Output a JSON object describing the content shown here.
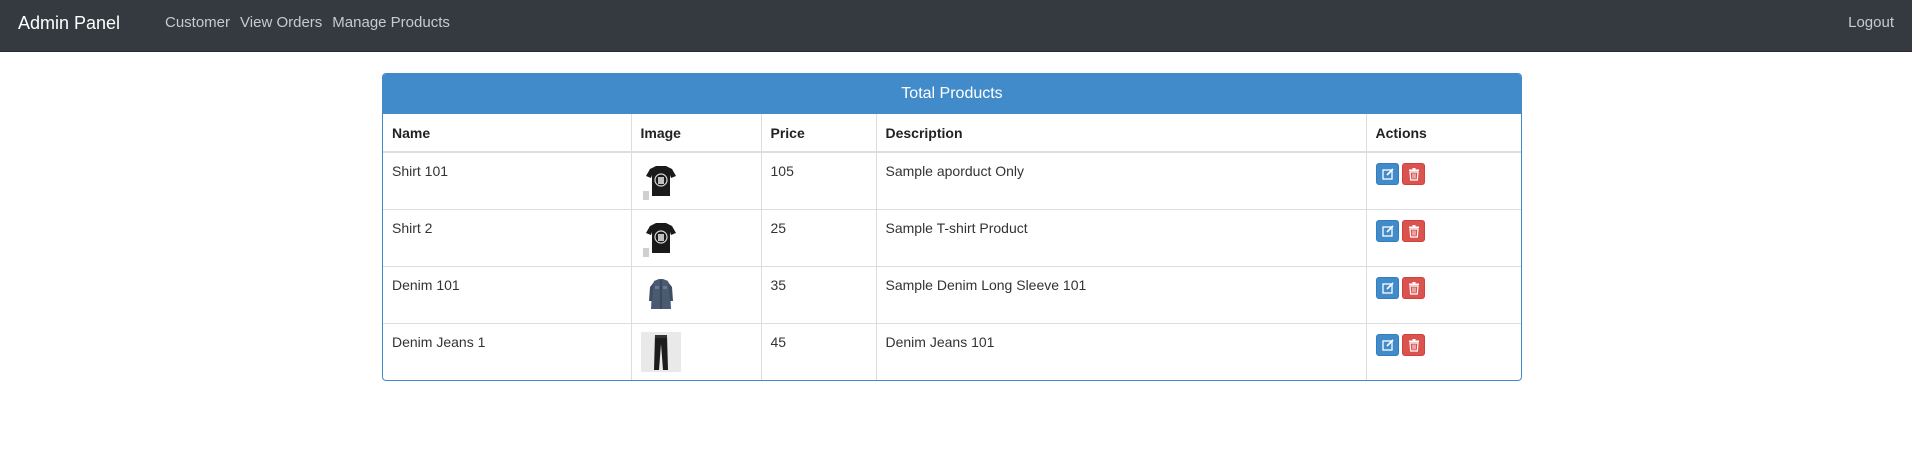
{
  "navbar": {
    "brand": "Admin Panel",
    "links": [
      "Customer",
      "View Orders",
      "Manage Products"
    ],
    "logout": "Logout"
  },
  "panel": {
    "title": "Total Products"
  },
  "table": {
    "headers": [
      "Name",
      "Image",
      "Price",
      "Description",
      "Actions"
    ],
    "rows": [
      {
        "name": "Shirt 101",
        "image": "tshirt-image",
        "price": "105",
        "description": "Sample aporduct Only"
      },
      {
        "name": "Shirt 2",
        "image": "tshirt-image",
        "price": "25",
        "description": "Sample T-shirt Product"
      },
      {
        "name": "Denim 101",
        "image": "denim-shirt-image",
        "price": "35",
        "description": "Sample Denim Long Sleeve 101"
      },
      {
        "name": "Denim Jeans 1",
        "image": "jeans-image",
        "price": "45",
        "description": "Denim Jeans 101"
      }
    ]
  },
  "icons": {
    "edit": "edit-icon",
    "delete": "trash-icon"
  },
  "colors": {
    "navbar": "#343a40",
    "primary": "#428bca",
    "danger": "#d9534f"
  }
}
